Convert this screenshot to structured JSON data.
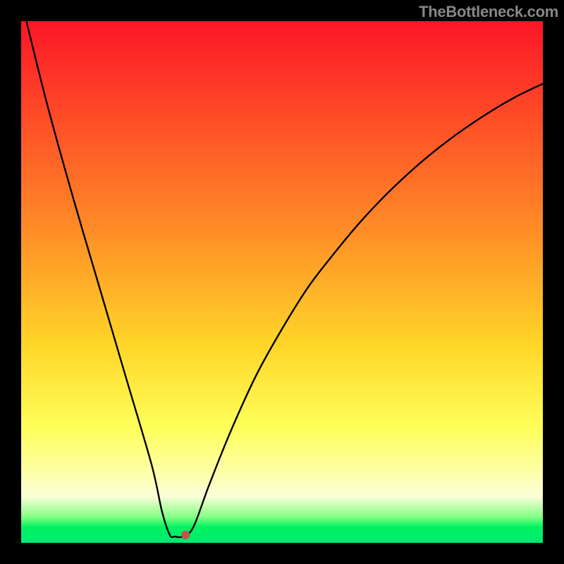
{
  "attribution": "TheBottleneck.com",
  "chart_data": {
    "type": "line",
    "title": "",
    "xlabel": "",
    "ylabel": "",
    "xlim": [
      0,
      100
    ],
    "ylim": [
      0,
      100
    ],
    "series": [
      {
        "name": "bottleneck-curve",
        "points": [
          {
            "x": 1,
            "y": 100
          },
          {
            "x": 5,
            "y": 84
          },
          {
            "x": 10,
            "y": 66
          },
          {
            "x": 15,
            "y": 49
          },
          {
            "x": 20,
            "y": 32
          },
          {
            "x": 25,
            "y": 15
          },
          {
            "x": 27,
            "y": 6
          },
          {
            "x": 28.5,
            "y": 1.5
          },
          {
            "x": 29.5,
            "y": 1.2
          },
          {
            "x": 31,
            "y": 1.2
          },
          {
            "x": 33,
            "y": 3
          },
          {
            "x": 36,
            "y": 11
          },
          {
            "x": 40,
            "y": 21
          },
          {
            "x": 45,
            "y": 32
          },
          {
            "x": 50,
            "y": 41
          },
          {
            "x": 55,
            "y": 49
          },
          {
            "x": 60,
            "y": 55.5
          },
          {
            "x": 65,
            "y": 61.5
          },
          {
            "x": 70,
            "y": 66.8
          },
          {
            "x": 75,
            "y": 71.5
          },
          {
            "x": 80,
            "y": 75.7
          },
          {
            "x": 85,
            "y": 79.4
          },
          {
            "x": 90,
            "y": 82.7
          },
          {
            "x": 95,
            "y": 85.6
          },
          {
            "x": 100,
            "y": 88
          }
        ]
      }
    ],
    "marker": {
      "x": 31.5,
      "y": 1.5,
      "color": "#c1544b",
      "radius": 6
    }
  }
}
